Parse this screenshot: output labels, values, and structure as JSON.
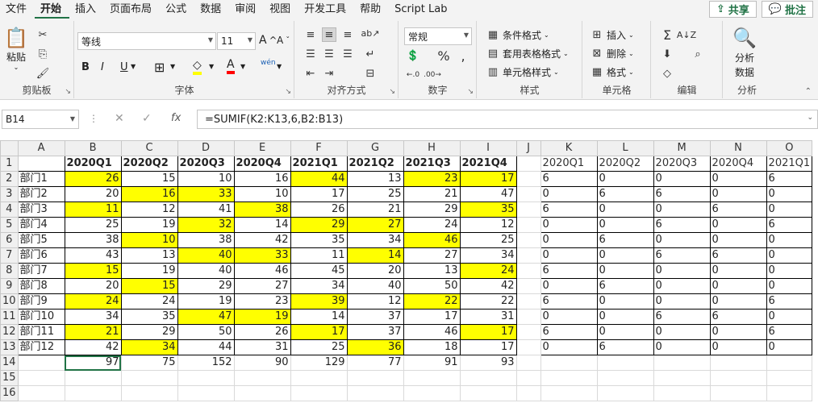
{
  "menu": {
    "tabs": [
      "文件",
      "开始",
      "插入",
      "页面布局",
      "公式",
      "数据",
      "审阅",
      "视图",
      "开发工具",
      "帮助",
      "Script Lab"
    ],
    "active": "开始",
    "share_label": "共享",
    "comment_label": "批注"
  },
  "ribbon": {
    "clipboard": {
      "label": "剪贴板",
      "paste": "粘贴"
    },
    "font": {
      "label": "字体",
      "font_name": "等线",
      "font_size": "11",
      "bold": "B",
      "italic": "I",
      "underline": "U",
      "phonetic": "wén"
    },
    "alignment": {
      "label": "对齐方式"
    },
    "number": {
      "label": "数字",
      "format": "常规"
    },
    "styles": {
      "label": "样式",
      "conditional": "条件格式",
      "table_format": "套用表格格式",
      "cell_styles": "单元格样式"
    },
    "cells": {
      "label": "单元格",
      "insert": "插入",
      "delete": "删除",
      "format": "格式"
    },
    "editing": {
      "label": "编辑"
    },
    "analysis": {
      "label": "分析",
      "analyze_data": "分析\n数据",
      "analyze_line1": "分析",
      "analyze_line2": "数据"
    }
  },
  "formula_bar": {
    "name_box": "B14",
    "formula": "=SUMIF(K2:K13,6,B2:B13)"
  },
  "sheet": {
    "columns": [
      "A",
      "B",
      "C",
      "D",
      "E",
      "F",
      "G",
      "H",
      "I",
      "J",
      "K",
      "L",
      "M",
      "N",
      "O"
    ],
    "rows": [
      "1",
      "2",
      "3",
      "4",
      "5",
      "6",
      "7",
      "8",
      "9",
      "10",
      "11",
      "12",
      "13",
      "14",
      "15",
      "16"
    ],
    "headers": [
      "2020Q1",
      "2020Q2",
      "2020Q3",
      "2020Q4",
      "2021Q1",
      "2021Q2",
      "2021Q3",
      "2021Q4"
    ],
    "helper_headers": [
      "2020Q1",
      "2020Q2",
      "2020Q3",
      "2020Q4",
      "2021Q1"
    ],
    "data": [
      {
        "name": "部门1",
        "values": [
          "26",
          "15",
          "10",
          "16",
          "44",
          "13",
          "23",
          "17"
        ],
        "hl": [
          1,
          0,
          0,
          0,
          1,
          0,
          1,
          1
        ],
        "helper": [
          "6",
          "0",
          "0",
          "0",
          "6"
        ]
      },
      {
        "name": "部门2",
        "values": [
          "20",
          "16",
          "33",
          "10",
          "17",
          "25",
          "21",
          "47"
        ],
        "hl": [
          0,
          1,
          1,
          0,
          0,
          0,
          0,
          0
        ],
        "helper": [
          "0",
          "6",
          "6",
          "0",
          "0"
        ]
      },
      {
        "name": "部门3",
        "values": [
          "11",
          "12",
          "41",
          "38",
          "26",
          "21",
          "29",
          "35"
        ],
        "hl": [
          1,
          0,
          0,
          1,
          0,
          0,
          0,
          1
        ],
        "helper": [
          "6",
          "0",
          "0",
          "6",
          "0"
        ]
      },
      {
        "name": "部门4",
        "values": [
          "25",
          "19",
          "32",
          "14",
          "29",
          "27",
          "24",
          "12"
        ],
        "hl": [
          0,
          0,
          1,
          0,
          1,
          1,
          0,
          0
        ],
        "helper": [
          "0",
          "0",
          "6",
          "0",
          "6"
        ]
      },
      {
        "name": "部门5",
        "values": [
          "38",
          "10",
          "38",
          "42",
          "35",
          "34",
          "46",
          "25"
        ],
        "hl": [
          0,
          1,
          0,
          0,
          0,
          0,
          1,
          0
        ],
        "helper": [
          "0",
          "6",
          "0",
          "0",
          "0"
        ]
      },
      {
        "name": "部门6",
        "values": [
          "43",
          "13",
          "40",
          "33",
          "11",
          "14",
          "27",
          "34"
        ],
        "hl": [
          0,
          0,
          1,
          1,
          0,
          1,
          0,
          0
        ],
        "helper": [
          "0",
          "0",
          "6",
          "6",
          "0"
        ]
      },
      {
        "name": "部门7",
        "values": [
          "15",
          "19",
          "40",
          "46",
          "45",
          "20",
          "13",
          "24"
        ],
        "hl": [
          1,
          0,
          0,
          0,
          0,
          0,
          0,
          1
        ],
        "helper": [
          "6",
          "0",
          "0",
          "0",
          "0"
        ]
      },
      {
        "name": "部门8",
        "values": [
          "20",
          "15",
          "29",
          "27",
          "34",
          "40",
          "50",
          "42"
        ],
        "hl": [
          0,
          1,
          0,
          0,
          0,
          0,
          0,
          0
        ],
        "helper": [
          "0",
          "6",
          "0",
          "0",
          "0"
        ]
      },
      {
        "name": "部门9",
        "values": [
          "24",
          "24",
          "19",
          "23",
          "39",
          "12",
          "22",
          "22"
        ],
        "hl": [
          1,
          0,
          0,
          0,
          1,
          0,
          1,
          0
        ],
        "helper": [
          "6",
          "0",
          "0",
          "0",
          "6"
        ]
      },
      {
        "name": "部门10",
        "values": [
          "34",
          "35",
          "47",
          "19",
          "14",
          "37",
          "17",
          "31"
        ],
        "hl": [
          0,
          0,
          1,
          1,
          0,
          0,
          0,
          0
        ],
        "helper": [
          "0",
          "0",
          "6",
          "6",
          "0"
        ]
      },
      {
        "name": "部门11",
        "values": [
          "21",
          "29",
          "50",
          "26",
          "17",
          "37",
          "46",
          "17"
        ],
        "hl": [
          1,
          0,
          0,
          0,
          1,
          0,
          0,
          1
        ],
        "helper": [
          "6",
          "0",
          "0",
          "0",
          "6"
        ]
      },
      {
        "name": "部门12",
        "values": [
          "42",
          "34",
          "44",
          "31",
          "25",
          "36",
          "18",
          "17"
        ],
        "hl": [
          0,
          1,
          0,
          0,
          0,
          1,
          0,
          0
        ],
        "helper": [
          "0",
          "6",
          "0",
          "0",
          "0"
        ]
      }
    ],
    "totals": [
      "97",
      "75",
      "152",
      "90",
      "129",
      "77",
      "91",
      "93"
    ]
  }
}
